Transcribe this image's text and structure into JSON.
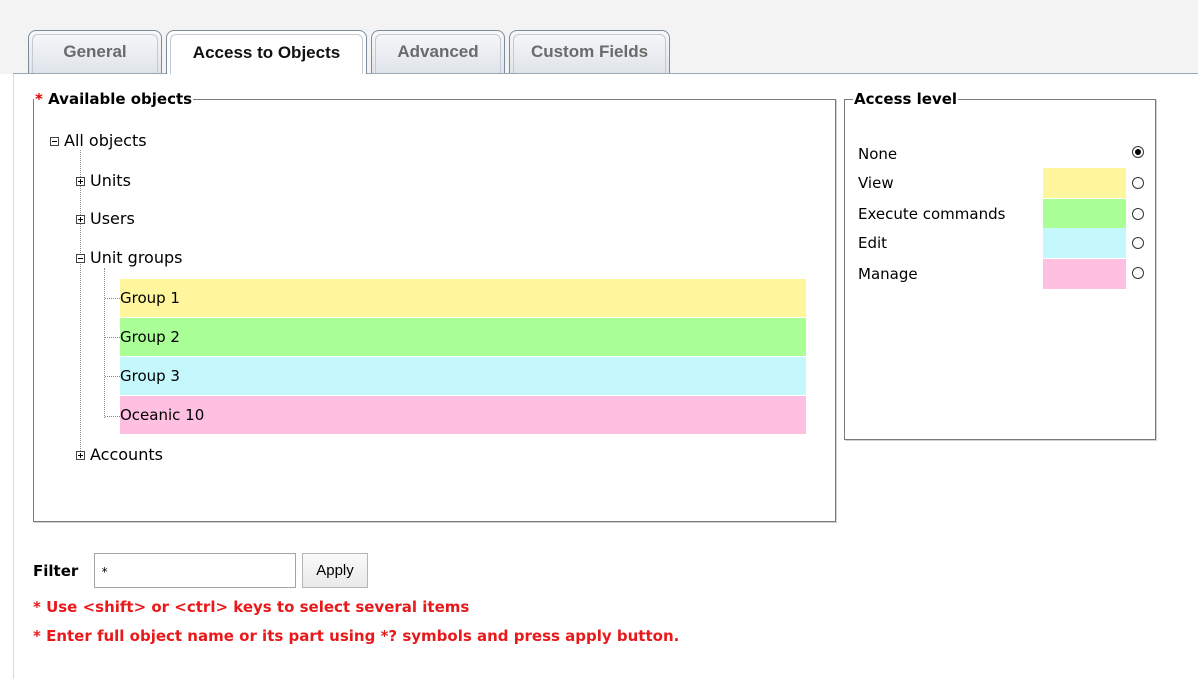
{
  "tabs": [
    {
      "label": "General",
      "active": false
    },
    {
      "label": "Access to Objects",
      "active": true
    },
    {
      "label": "Advanced",
      "active": false
    },
    {
      "label": "Custom Fields",
      "active": false
    }
  ],
  "available_objects": {
    "required_mark": "*",
    "title": "Available objects",
    "root": "All objects",
    "units": "Units",
    "users": "Users",
    "unit_groups": "Unit groups",
    "groups": [
      {
        "label": "Group 1",
        "color": "#fff59d"
      },
      {
        "label": "Group 2",
        "color": "#aaff96"
      },
      {
        "label": "Group 3",
        "color": "#c4f8fc"
      },
      {
        "label": "Oceanic 10",
        "color": "#ffbfe1"
      }
    ],
    "accounts": "Accounts"
  },
  "access_level": {
    "title": "Access level",
    "levels": [
      {
        "label": "None",
        "color": "",
        "selected": true
      },
      {
        "label": "View",
        "color": "#fff59d",
        "selected": false
      },
      {
        "label": "Execute commands",
        "color": "#aaff96",
        "selected": false
      },
      {
        "label": "Edit",
        "color": "#c4f8fc",
        "selected": false
      },
      {
        "label": "Manage",
        "color": "#ffbfe1",
        "selected": false
      }
    ]
  },
  "filter": {
    "label": "Filter",
    "value": "*",
    "apply_label": "Apply"
  },
  "hints": [
    "* Use <shift> or <ctrl> keys to select several items",
    "* Enter full object name or its part using *? symbols and press apply button."
  ]
}
